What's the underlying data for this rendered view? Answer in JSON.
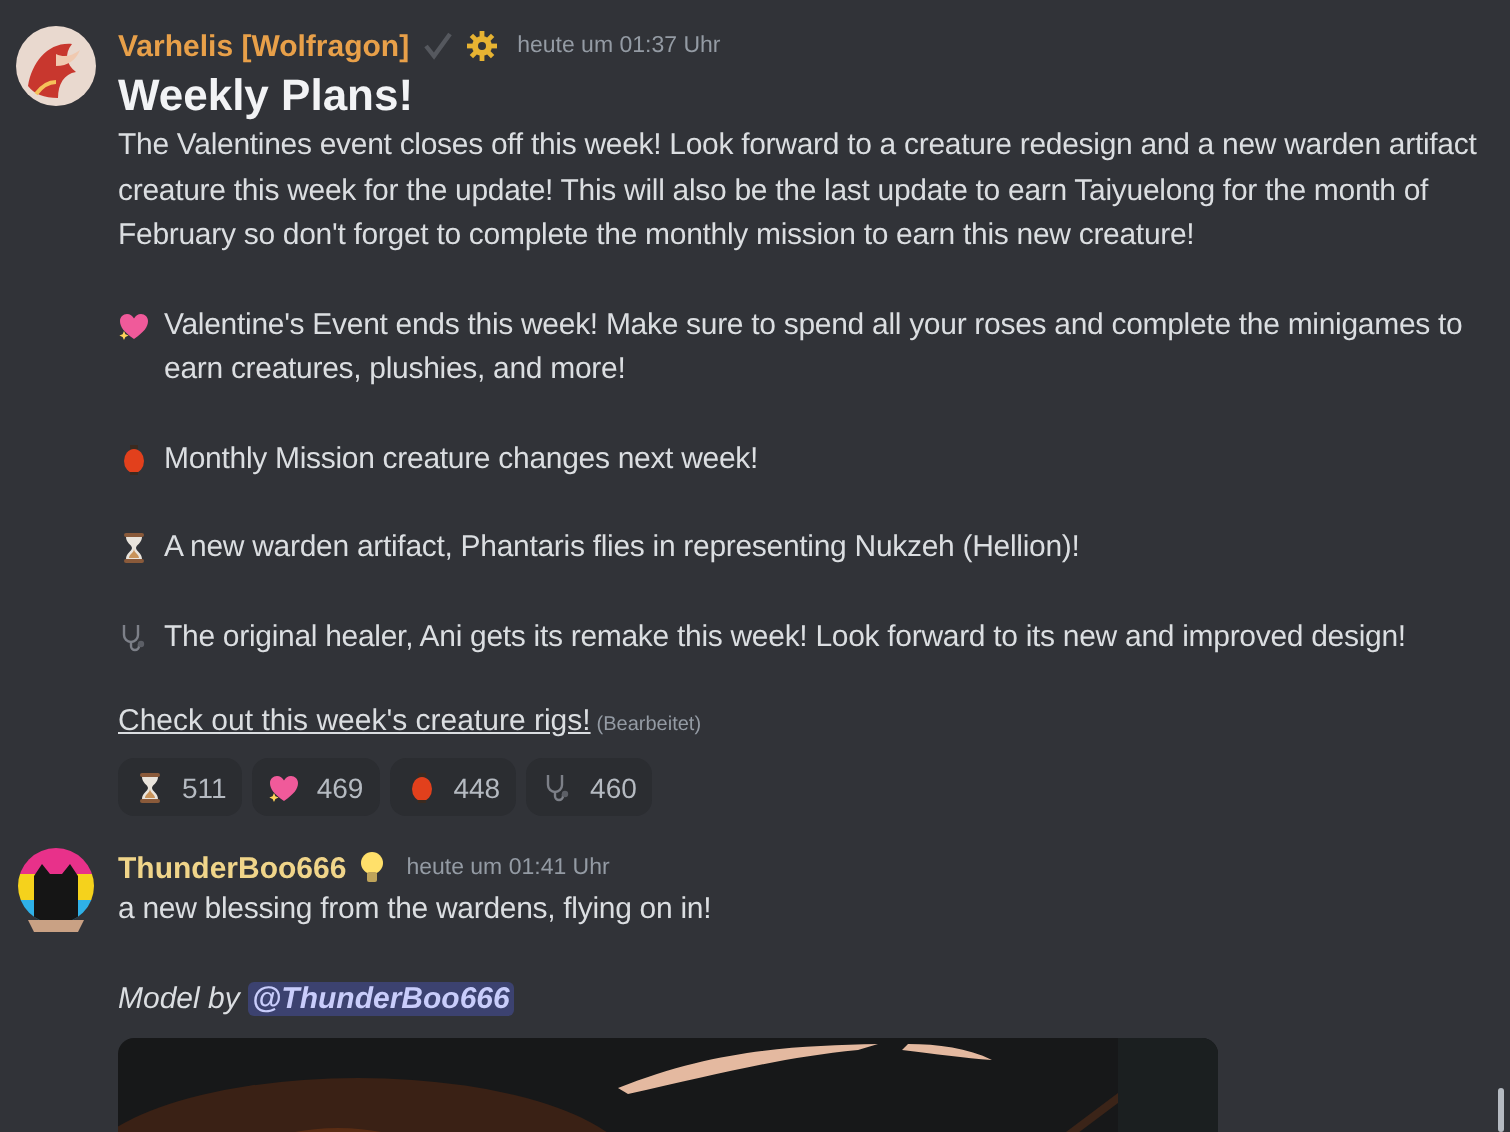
{
  "messages": [
    {
      "author": "Varhelis [Wolfragon]",
      "timestamp": "heute um 01:37 Uhr",
      "title": "Weekly Plans!",
      "paragraphs": [
        "The Valentines event closes off this week! Look forward to a creature redesign and a new warden artifact creature this week for the update! This will also be the last update to earn Taiyuelong for the month of February so don't forget to complete the monthly mission to earn this new creature!",
        "Valentine's Event ends this week! Make sure to spend all your roses and complete the minigames to earn creatures, plushies, and more!",
        "Monthly Mission creature changes next week!",
        "A new warden artifact, Phantaris flies in representing Nukzeh (Hellion)!",
        "The original healer, Ani gets its remake this week! Look forward to its new and improved design!"
      ],
      "link": "Check out this week's creature rigs!",
      "edited": "(Bearbeitet)",
      "reactions": [
        "511",
        "469",
        "448",
        "460"
      ]
    },
    {
      "author": "ThunderBoo666",
      "timestamp": "heute um 01:41 Uhr",
      "paragraphs": [
        "a new blessing from the wardens, flying on in!"
      ],
      "credit": {
        "prefix": "Model by",
        "mention": "@ThunderBoo666"
      }
    }
  ]
}
